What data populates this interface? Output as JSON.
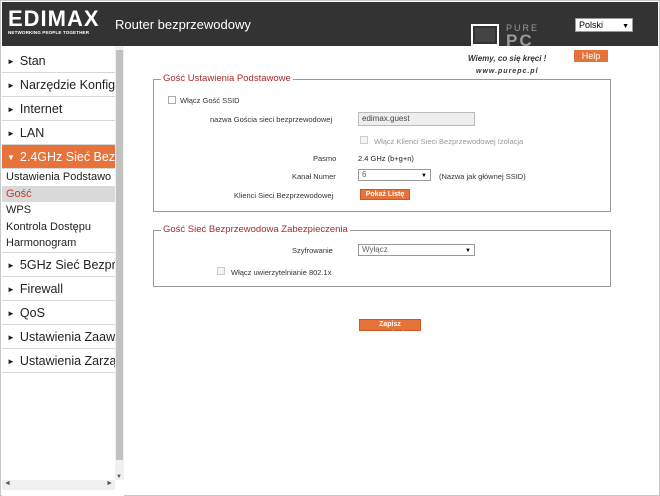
{
  "header": {
    "logo_text": "EDIMAX",
    "logo_tagline": "NETWORKING PEOPLE TOGETHER",
    "app_title": "Router bezprzewodowy",
    "language": "Polski",
    "help_label": "Help"
  },
  "watermark": {
    "brand_top": "PURE",
    "brand_bottom": "PC",
    "slogan": "Wiemy, co się kręci !",
    "url": "www.purepc.pl"
  },
  "sidebar": {
    "items": [
      {
        "label": "Stan"
      },
      {
        "label": "Narzędzie Konfig"
      },
      {
        "label": "Internet"
      },
      {
        "label": "LAN"
      },
      {
        "label": "2.4GHz Sieć Bez"
      },
      {
        "label": "5GHz Sieć Bezpr"
      },
      {
        "label": "Firewall"
      },
      {
        "label": "QoS"
      },
      {
        "label": "Ustawienia Zaaw"
      },
      {
        "label": "Ustawienia Zarzą"
      }
    ],
    "subitems": [
      {
        "label": "Ustawienia Podstawo"
      },
      {
        "label": "Gość"
      },
      {
        "label": "WPS"
      },
      {
        "label": "Kontrola Dostępu"
      },
      {
        "label": "Harmonogram"
      }
    ]
  },
  "basic": {
    "legend": "Gość  Ustawienia Podstawowe",
    "enable_ssid_label": "Włącz  Gość  SSID",
    "ssid_name_label": "nazwa Gościa sieci bezprzewodowej",
    "ssid_name_value": "edimax.guest",
    "isolation_label": "Włącz Klienci Sieci Bezprzewodowej Izolacja",
    "band_label": "Pasmo",
    "band_value": "2.4 GHz (b+g+n)",
    "channel_label": "Kanał Numer",
    "channel_value": "6",
    "channel_note": "(Nazwa jak głównej SSID)",
    "clients_label": "Klienci Sieci Bezprzewodowej",
    "show_list_label": "Pokaż Listę"
  },
  "security": {
    "legend": "Gość  Sieć Bezprzewodowa  Zabezpieczenia",
    "encryption_label": "Szyfrowanie",
    "encryption_value": "Wyłącz",
    "auth_8021x_label": "Włącz uwierzytelnianie 802.1x"
  },
  "actions": {
    "save_label": "Zapisz Ustawienia"
  },
  "colors": {
    "accent": "#e8733a",
    "header_bg": "#333333",
    "legend": "#a52a2a"
  }
}
